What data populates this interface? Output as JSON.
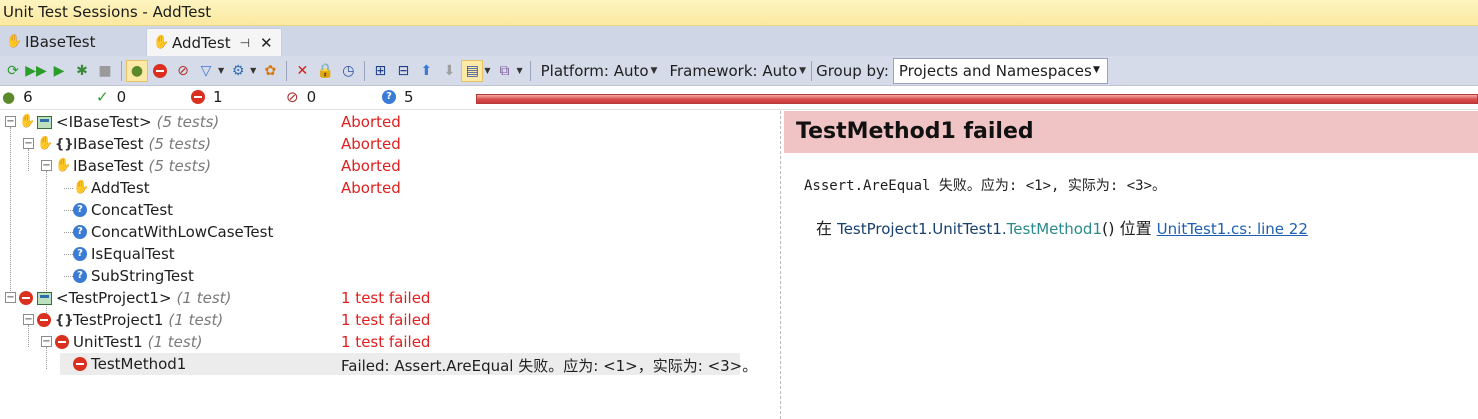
{
  "window": {
    "title": "Unit Test Sessions - AddTest"
  },
  "tabs": [
    {
      "label": "IBaseTest",
      "icon": "aborted-hand-icon"
    },
    {
      "label": "AddTest",
      "icon": "aborted-hand-icon",
      "pin": "⊣",
      "close": "✕"
    }
  ],
  "toolbar": {
    "platform_label": "Platform: Auto",
    "framework_label": "Framework: Auto",
    "groupby_label": "Group by:",
    "groupby_value": "Projects and Namespaces"
  },
  "stats": {
    "total": "6",
    "passed": "0",
    "failed": "1",
    "ignored": "0",
    "unknown": "5",
    "progress_percent": 100,
    "progress_color": "#d84a4a"
  },
  "tree": {
    "rows": [
      {
        "name": "<IBaseTest>",
        "count": "(5 tests)",
        "status": "Aborted",
        "icon": "aborted-hand-icon"
      },
      {
        "name": "IBaseTest",
        "count": "(5 tests)",
        "status": "Aborted",
        "icon": "aborted-hand-icon"
      },
      {
        "name": "IBaseTest",
        "count": "(5 tests)",
        "status": "Aborted",
        "icon": "aborted-hand-icon"
      },
      {
        "name": "AddTest",
        "count": "",
        "status": "Aborted",
        "icon": "aborted-hand-icon"
      },
      {
        "name": "ConcatTest",
        "count": "",
        "status": "",
        "icon": "unknown-question-icon"
      },
      {
        "name": "ConcatWithLowCaseTest",
        "count": "",
        "status": "",
        "icon": "unknown-question-icon"
      },
      {
        "name": "IsEqualTest",
        "count": "",
        "status": "",
        "icon": "unknown-question-icon"
      },
      {
        "name": "SubStringTest",
        "count": "",
        "status": "",
        "icon": "unknown-question-icon"
      },
      {
        "name": "<TestProject1>",
        "count": "(1 test)",
        "status": "1 test failed",
        "icon": "failed-icon"
      },
      {
        "name": "TestProject1",
        "count": "(1 test)",
        "status": "1 test failed",
        "icon": "failed-icon"
      },
      {
        "name": "UnitTest1",
        "count": "(1 test)",
        "status": "1 test failed",
        "icon": "failed-icon"
      },
      {
        "name": "TestMethod1",
        "count": "",
        "status": "Failed: Assert.AreEqual 失败。应为: <1>，实际为: <3>。",
        "icon": "failed-icon"
      }
    ]
  },
  "details": {
    "heading": "TestMethod1 failed",
    "message": "Assert.AreEqual 失败。应为: <1>, 实际为: <3>。",
    "stack_prefix": "在 ",
    "stack_namespace": "TestProject1.UnitTest1.",
    "stack_method": "TestMethod1",
    "stack_parens": "() 位置 ",
    "stack_link": "UnitTest1.cs: line 22",
    "heading_bg": "#f0c4c4"
  }
}
